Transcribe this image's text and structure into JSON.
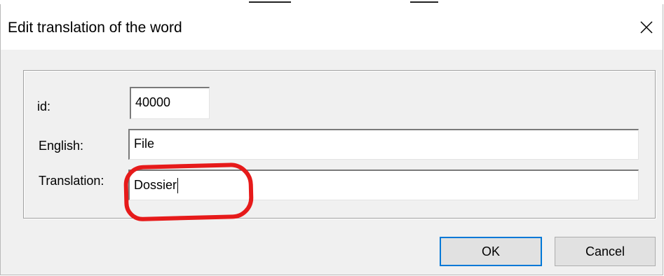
{
  "dialog": {
    "title": "Edit translation of the word",
    "close_icon": "close-icon"
  },
  "form": {
    "id_label": "id:",
    "id_value": "40000",
    "english_label": "English:",
    "english_value": "File",
    "translation_label": "Translation:",
    "translation_value": "Dossier"
  },
  "buttons": {
    "ok_label": "OK",
    "cancel_label": "Cancel"
  },
  "annotation": {
    "highlight_color": "#e61a1a"
  },
  "colors": {
    "dialog_bg": "#f0f0f0",
    "title_bg": "#ffffff",
    "default_button_border": "#0078d7"
  }
}
